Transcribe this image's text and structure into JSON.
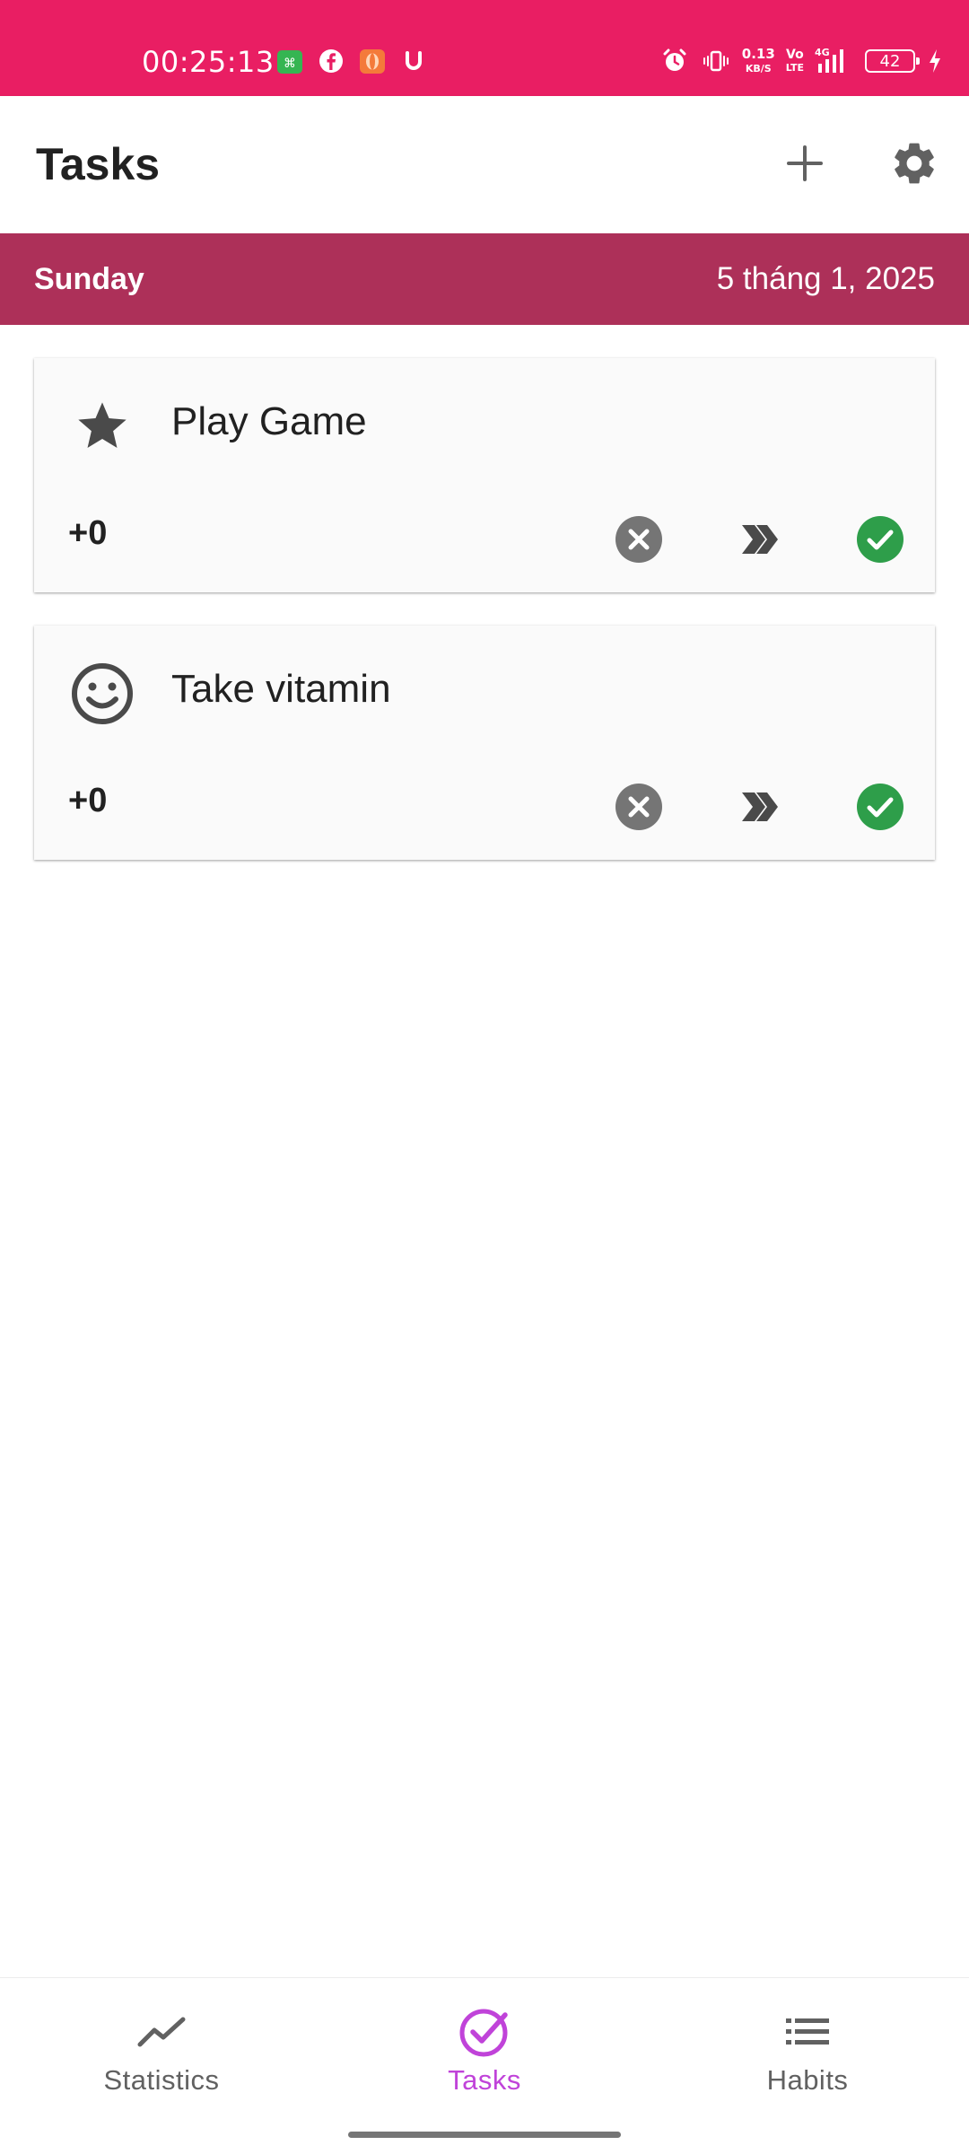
{
  "status_bar": {
    "time": "00:25:13",
    "net_speed_value": "0.13",
    "net_speed_unit": "KB/S",
    "volte_top": "Vo",
    "volte_bottom": "LTE",
    "network": "4G",
    "battery": "42",
    "background_color": "#E91E63"
  },
  "app_bar": {
    "title": "Tasks",
    "add_icon": "plus-icon",
    "settings_icon": "gear-icon"
  },
  "date_header": {
    "day": "Sunday",
    "date": "5 tháng 1, 2025",
    "background_color": "#AD3059"
  },
  "tasks": [
    {
      "icon": "star-icon",
      "title": "Play Game",
      "score": "+0"
    },
    {
      "icon": "smiley-icon",
      "title": "Take vitamin",
      "score": "+0"
    }
  ],
  "task_actions": {
    "fail_icon": "close-circle-icon",
    "skip_icon": "double-chevron-right-icon",
    "done_icon": "check-circle-icon",
    "done_color": "#2E9E4A",
    "fail_color": "#757575"
  },
  "bottom_nav": {
    "items": [
      {
        "label": "Statistics",
        "icon": "trend-line-icon",
        "active": false
      },
      {
        "label": "Tasks",
        "icon": "check-circle-outline-icon",
        "active": true
      },
      {
        "label": "Habits",
        "icon": "list-icon",
        "active": false
      }
    ],
    "active_color": "#C043D9"
  }
}
